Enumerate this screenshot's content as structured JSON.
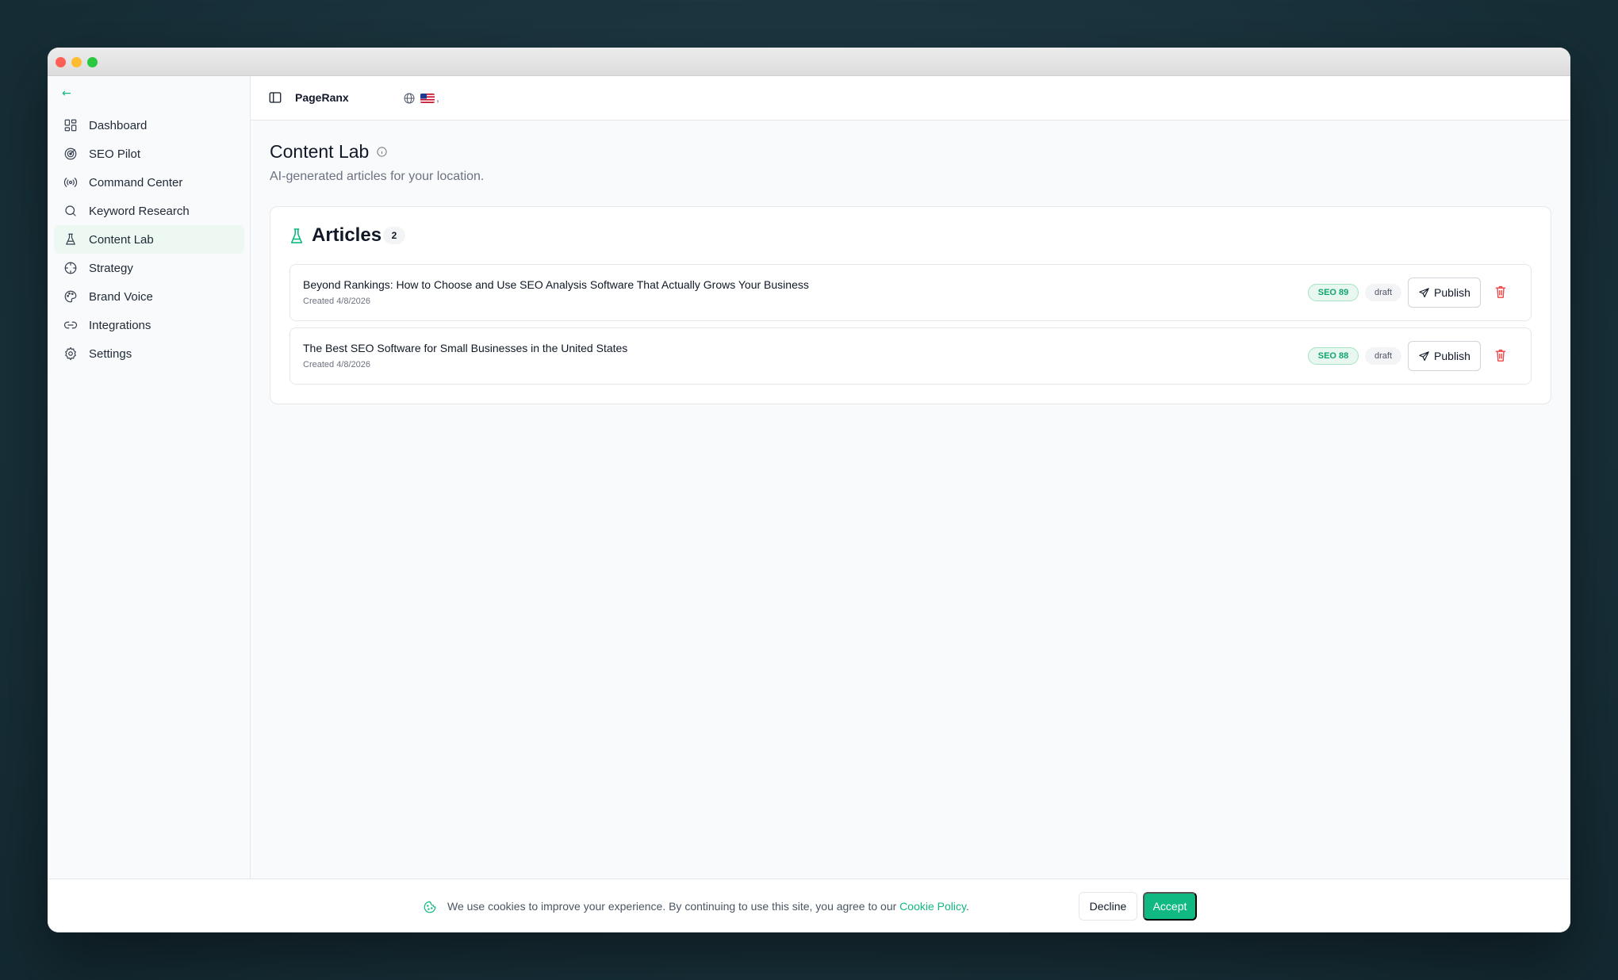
{
  "app": {
    "brand": "PageRanx",
    "accent_color": "#10b981",
    "danger_color": "#ef4444",
    "flag_icon": "us-flag-icon",
    "flag_suffix": ","
  },
  "sidebar": {
    "collapse_icon": "arrow-left-icon",
    "items": [
      {
        "label": "Dashboard",
        "icon": "layout-grid-icon",
        "active": false
      },
      {
        "label": "SEO Pilot",
        "icon": "radar-icon",
        "active": false
      },
      {
        "label": "Command Center",
        "icon": "radio-broadcast-icon",
        "active": false
      },
      {
        "label": "Keyword Research",
        "icon": "search-icon",
        "active": false
      },
      {
        "label": "Content Lab",
        "icon": "flask-icon",
        "active": true
      },
      {
        "label": "Strategy",
        "icon": "crosshair-icon",
        "active": false
      },
      {
        "label": "Brand Voice",
        "icon": "palette-icon",
        "active": false
      },
      {
        "label": "Integrations",
        "icon": "link-icon",
        "active": false
      },
      {
        "label": "Settings",
        "icon": "gear-icon",
        "active": false
      }
    ]
  },
  "page": {
    "title": "Content Lab",
    "subtitle": "AI-generated articles for your location."
  },
  "articles_card": {
    "title": "Articles",
    "count": "2",
    "items": [
      {
        "title": "Beyond Rankings: How to Choose and Use SEO Analysis Software That Actually Grows Your Business",
        "created": "Created 4/8/2026",
        "seo": "SEO 89",
        "status": "draft",
        "publish_label": "Publish"
      },
      {
        "title": "The Best SEO Software for Small Businesses in the United States",
        "created": "Created 4/8/2026",
        "seo": "SEO 88",
        "status": "draft",
        "publish_label": "Publish"
      }
    ]
  },
  "cookie": {
    "text": "We use cookies to improve your experience. By continuing to use this site, you agree to our ",
    "link": "Cookie Policy",
    "suffix": ".",
    "decline": "Decline",
    "accept": "Accept"
  }
}
